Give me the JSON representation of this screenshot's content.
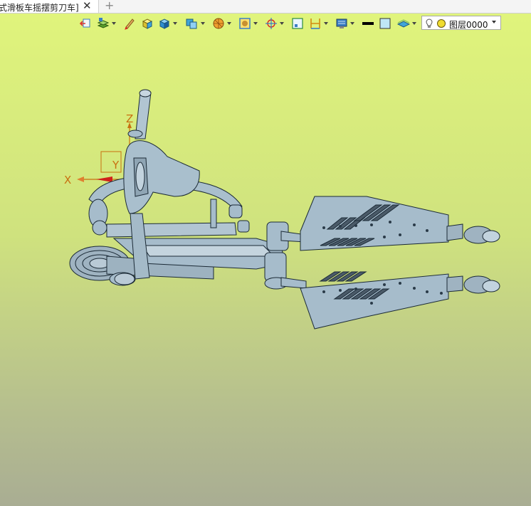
{
  "tab": {
    "title": "式滑板车摇摆剪刀车]",
    "close": "✕",
    "add": "+"
  },
  "toolbar": {
    "icons": [
      "exit-icon",
      "layers-icon",
      "pencil-icon",
      "cube-icon",
      "shaded-cube-icon",
      "view-cube-icon",
      "sphere-icon",
      "render-mode-icon",
      "snap-target-icon",
      "frame-icon",
      "dimension-icon",
      "display-settings-icon",
      "line-color-icon",
      "fill-color-icon",
      "plane-icon"
    ],
    "layer": {
      "name": "图层0000"
    }
  },
  "axes": {
    "x": "X",
    "y": "Y",
    "z": "Z"
  },
  "colors": {
    "model": "#a6bccb",
    "edge": "#1b2a36",
    "axis": "#c87010"
  }
}
